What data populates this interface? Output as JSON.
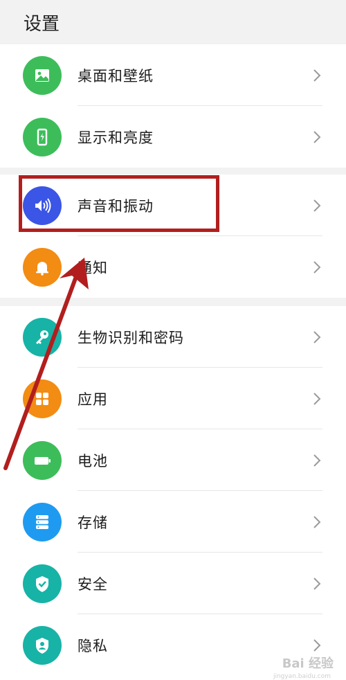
{
  "header": {
    "title": "设置"
  },
  "groups": [
    {
      "items": [
        {
          "label": "桌面和壁纸",
          "icon": "wallpaper-icon",
          "color": "#3dbd5a"
        },
        {
          "label": "显示和亮度",
          "icon": "display-brightness-icon",
          "color": "#3dbd5a"
        }
      ]
    },
    {
      "items": [
        {
          "label": "声音和振动",
          "icon": "speaker-icon",
          "color": "#3b55e6"
        },
        {
          "label": "通知",
          "icon": "bell-icon",
          "color": "#f28c12"
        }
      ]
    },
    {
      "items": [
        {
          "label": "生物识别和密码",
          "icon": "key-icon",
          "color": "#17b3a6"
        },
        {
          "label": "应用",
          "icon": "apps-grid-icon",
          "color": "#f28c12"
        },
        {
          "label": "电池",
          "icon": "battery-icon",
          "color": "#3dbd5a"
        },
        {
          "label": "存储",
          "icon": "storage-icon",
          "color": "#1e9bf0"
        },
        {
          "label": "安全",
          "icon": "shield-check-icon",
          "color": "#17b3a6"
        },
        {
          "label": "隐私",
          "icon": "privacy-shield-icon",
          "color": "#17b3a6"
        }
      ]
    }
  ],
  "annotation": {
    "highlight_color": "#b21e1e",
    "arrow_color": "#b21e1e"
  },
  "watermark": {
    "text": "Bai 经验",
    "sub": "jingyan.baidu.com"
  }
}
